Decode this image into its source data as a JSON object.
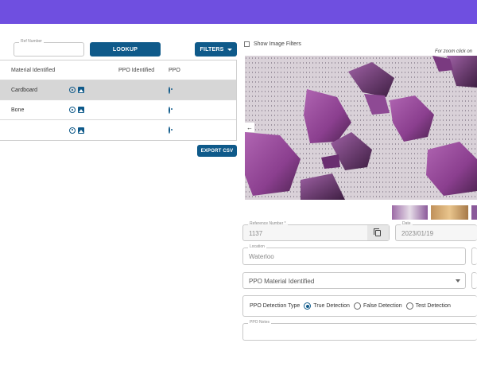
{
  "search": {
    "ref_label": "Ref Number",
    "ref_value": "",
    "lookup_label": "LOOKUP",
    "filters_label": "FILTERS"
  },
  "table": {
    "columns": [
      "Material Identified",
      "",
      "PPO Identified",
      "PPO"
    ],
    "rows": [
      {
        "material": "Cardboard",
        "ppo_identified": "",
        "selected": true
      },
      {
        "material": "Bone",
        "ppo_identified": "",
        "selected": false
      },
      {
        "material": "",
        "ppo_identified": "",
        "selected": false
      }
    ]
  },
  "export_label": "EXPORT CSV",
  "image_panel": {
    "show_filters_label": "Show Image Filters",
    "show_filters_checked": false,
    "zoom_note": "For zoom click on"
  },
  "form": {
    "reference_label": "Reference Number *",
    "reference_value": "1137",
    "date_label": "Date",
    "date_value": "2023/01/19",
    "location_label": "Location",
    "location_value": "Waterloo",
    "ppo_material_placeholder": "PPO Material Identified",
    "detection_type_label": "PPO Detection Type",
    "detection_options": [
      "True Detection",
      "False Detection",
      "Test Detection"
    ],
    "detection_selected": "True Detection",
    "notes_label": "PPO Notes",
    "notes_value": ""
  },
  "colors": {
    "topbar": "#6f4fe0",
    "primary": "#0f5a8a",
    "selected_row": "#d6d6d6"
  }
}
